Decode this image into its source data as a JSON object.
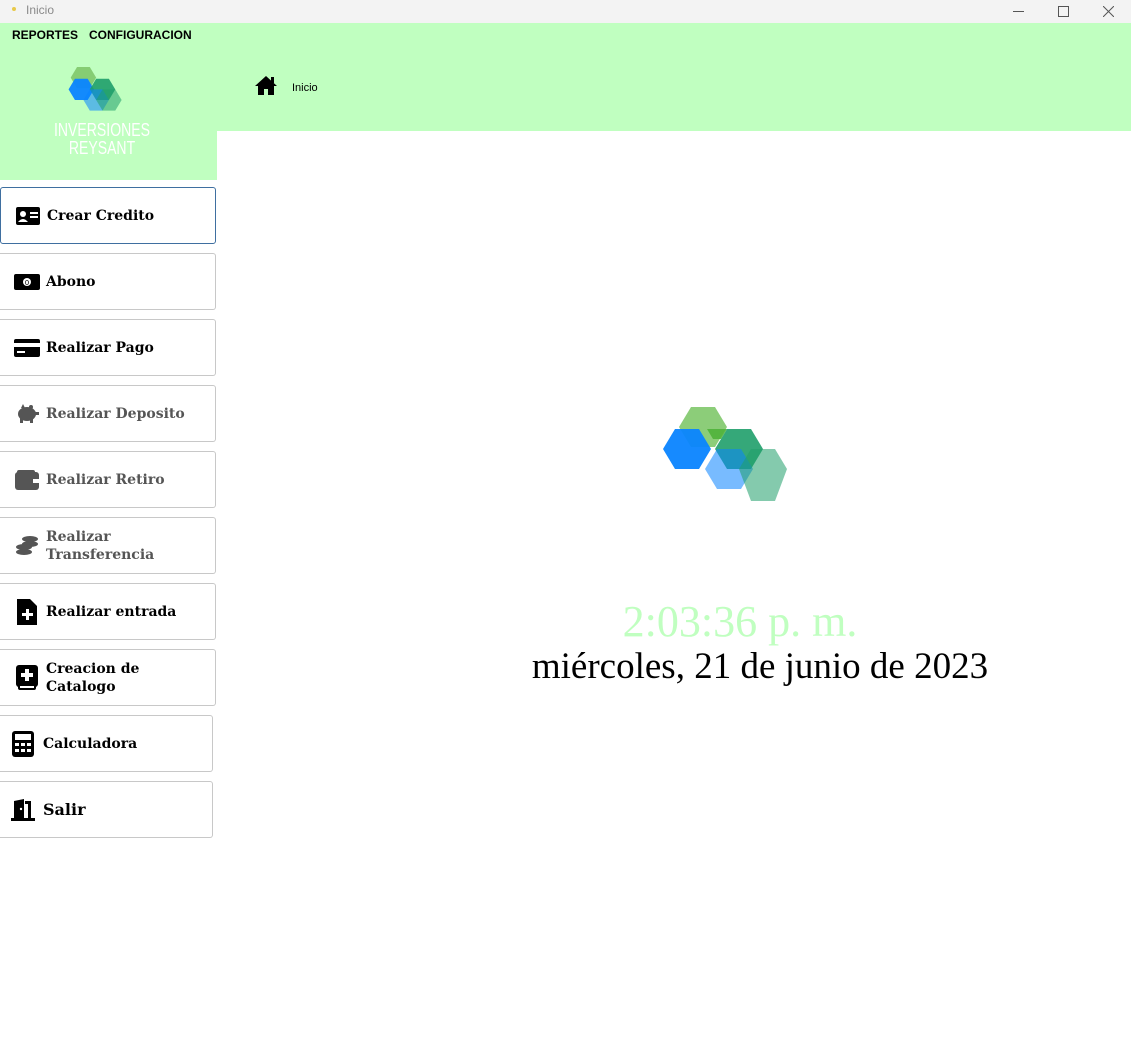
{
  "window": {
    "title": "Inicio"
  },
  "menu": {
    "items": [
      {
        "label": "REPORTES"
      },
      {
        "label": "CONFIGURACION"
      }
    ]
  },
  "brand": {
    "name_line1": "INVERSIONES",
    "name_line2": "REYSANT"
  },
  "breadcrumb": {
    "icon": "home-icon",
    "label": "Inicio"
  },
  "sidebar": {
    "items": [
      {
        "label": "Crear Credito",
        "icon": "id-card-icon",
        "active": true
      },
      {
        "label": "Abono",
        "icon": "money-bill-icon"
      },
      {
        "label": "Realizar Pago",
        "icon": "credit-card-icon"
      },
      {
        "label": "Realizar Deposito",
        "icon": "piggy-bank-icon"
      },
      {
        "label": "Realizar Retiro",
        "icon": "wallet-icon"
      },
      {
        "label": "Realizar Transferencia",
        "icon": "coins-icon"
      },
      {
        "label": "Realizar entrada",
        "icon": "file-plus-icon"
      },
      {
        "label": "Creacion de Catalogo",
        "icon": "book-plus-icon"
      },
      {
        "label": "Calculadora",
        "icon": "calculator-icon"
      },
      {
        "label": "Salir",
        "icon": "door-exit-icon"
      }
    ]
  },
  "main": {
    "clock": "2:03:36 p. m.",
    "date": "miércoles, 21 de junio de 2023"
  },
  "colors": {
    "header_green": "#c0ffc0",
    "logo_blue": "#0a84ff",
    "logo_green": "#1f9e6a",
    "logo_light_green": "#7fc86a"
  }
}
